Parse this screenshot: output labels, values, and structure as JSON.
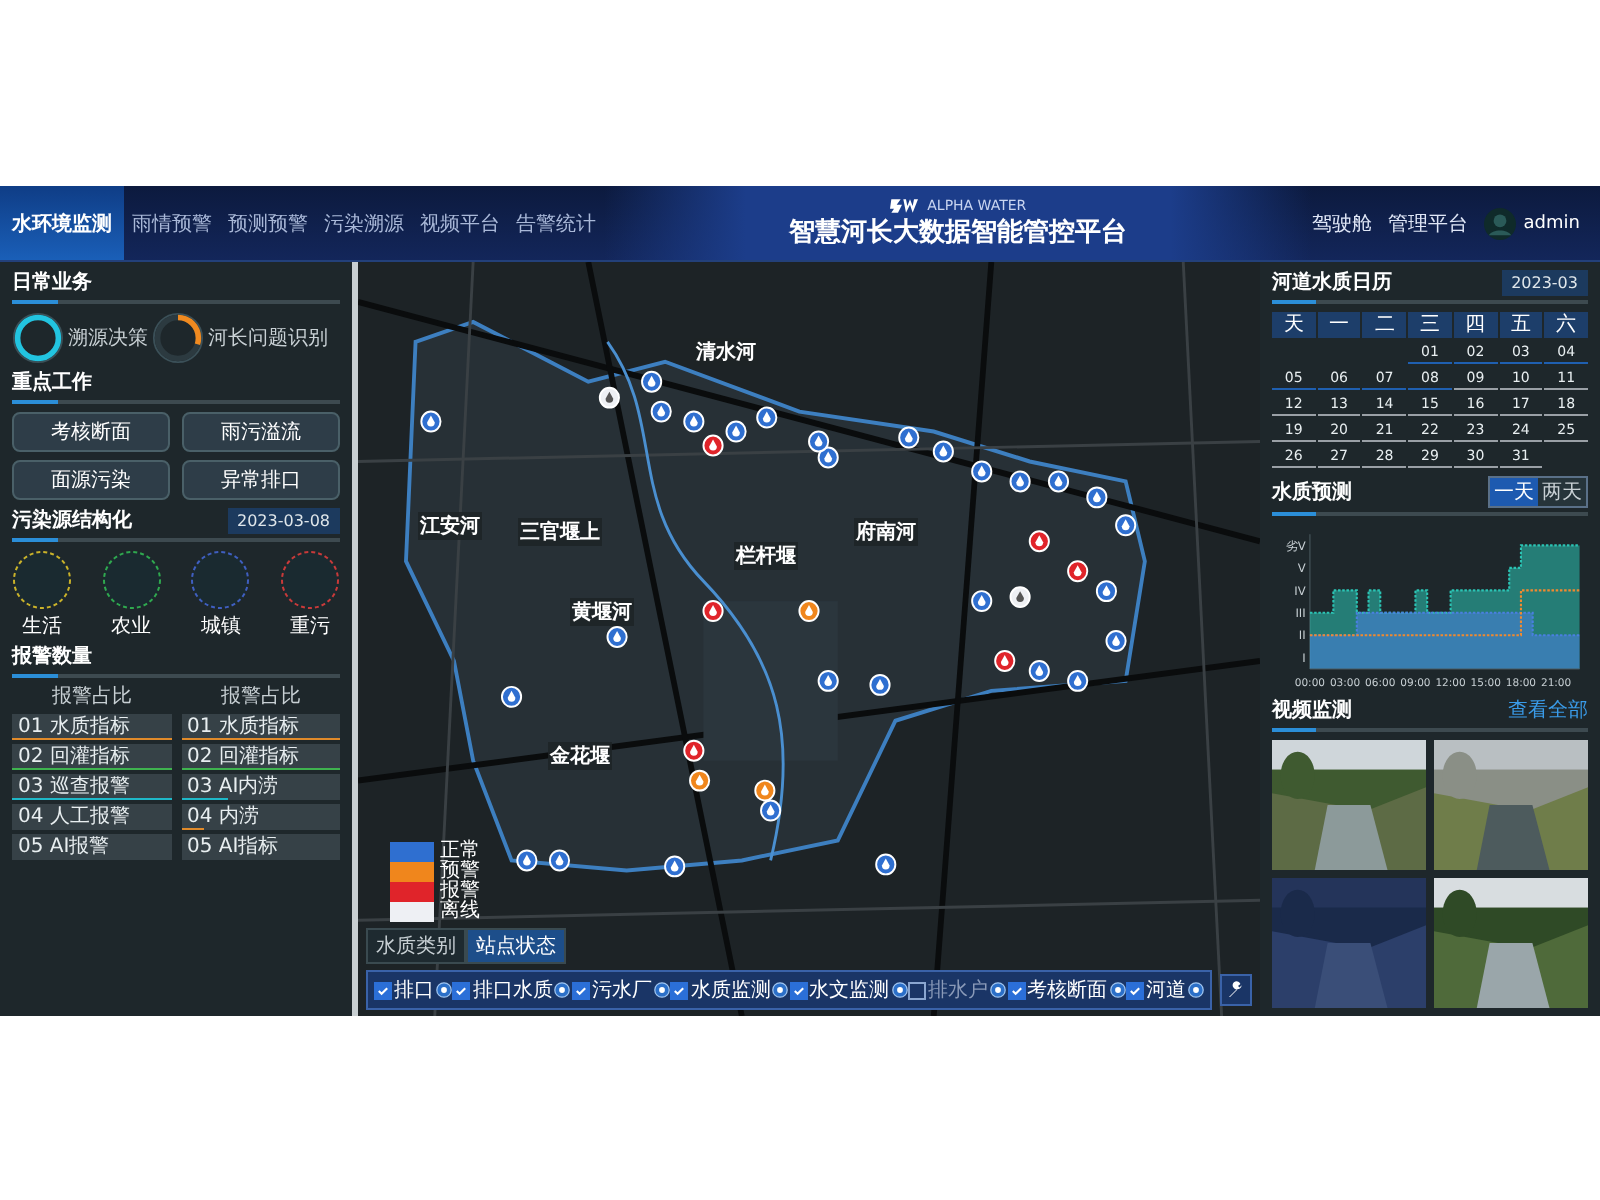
{
  "header": {
    "nav_tabs": [
      {
        "label": "水环境监测",
        "selected": true
      },
      {
        "label": "雨情预警",
        "selected": false
      },
      {
        "label": "预测预警",
        "selected": false
      },
      {
        "label": "污染溯源",
        "selected": false
      },
      {
        "label": "视频平台",
        "selected": false
      },
      {
        "label": "告警统计",
        "selected": false
      }
    ],
    "brand": "ALPHA WATER",
    "title": "智慧河长大数据智能管控平台",
    "links": [
      "驾驶舱",
      "管理平台"
    ],
    "user": "admin"
  },
  "left": {
    "daily": {
      "title": "日常业务",
      "gauges": [
        {
          "label": "溯源决策",
          "level": 1
        },
        {
          "label": "河长问题识别",
          "level": 0.3
        }
      ]
    },
    "key_work": {
      "title": "重点工作",
      "cards": [
        "考核断面",
        "雨污溢流",
        "面源污染",
        "异常排口"
      ]
    },
    "pollution": {
      "title": "污染源结构化",
      "date": "2023-03-08",
      "sources": [
        {
          "label": "生活",
          "color": "#c9b22a"
        },
        {
          "label": "农业",
          "color": "#2fa84f"
        },
        {
          "label": "城镇",
          "color": "#3f5fc0"
        },
        {
          "label": "重污",
          "color": "#c83a3a"
        }
      ]
    },
    "alarms": {
      "title": "报警数量",
      "columns": [
        {
          "heading": "报警占比",
          "rows": [
            {
              "label": "01 水质指标",
              "level": 1,
              "color": "#e08a2a"
            },
            {
              "label": "02 回灌指标",
              "level": 1,
              "color": "#3fb34f"
            },
            {
              "label": "03 巡查报警",
              "level": 1,
              "color": "#1fb8c8"
            },
            {
              "label": "04 人工报警"
            },
            {
              "label": "05 AI报警"
            }
          ]
        },
        {
          "heading": "报警占比",
          "rows": [
            {
              "label": "01 水质指标",
              "level": 1,
              "color": "#e08a2a"
            },
            {
              "label": "02 回灌指标",
              "level": 1,
              "color": "#3fb34f"
            },
            {
              "label": "03 AI内涝",
              "level": 0.3,
              "color": "#1fb8c8"
            },
            {
              "label": "04 内涝",
              "level": 0.15,
              "color": "#e08a2a"
            },
            {
              "label": "05 AI指标"
            }
          ]
        }
      ]
    }
  },
  "map": {
    "labels": [
      "江安河",
      "清水河",
      "三官堰上",
      "栏杆堰",
      "府南河",
      "黄堰河",
      "金花堰"
    ],
    "legend": [
      {
        "label": "正常",
        "color": "#2f6fd0"
      },
      {
        "label": "预警",
        "color": "#f0861c"
      },
      {
        "label": "报警",
        "color": "#e0242a"
      },
      {
        "label": "离线",
        "color": "#eef0f4"
      }
    ],
    "view_toggle": [
      {
        "label": "水质类别",
        "selected": false
      },
      {
        "label": "站点状态",
        "selected": true
      }
    ],
    "filters": [
      {
        "label": "排口",
        "checked": true
      },
      {
        "label": "排口水质",
        "checked": true
      },
      {
        "label": "污水厂",
        "checked": true
      },
      {
        "label": "水质监测",
        "checked": true
      },
      {
        "label": "水文监测",
        "checked": true
      },
      {
        "label": "排水户",
        "checked": false
      },
      {
        "label": "考核断面",
        "checked": true
      },
      {
        "label": "河道",
        "checked": true
      }
    ]
  },
  "right": {
    "calendar": {
      "title": "河道水质日历",
      "month": "2023-03",
      "weekdays": [
        "天",
        "一",
        "二",
        "三",
        "四",
        "五",
        "六"
      ],
      "days": [
        {
          "day": "01",
          "color": "#1f5fb0"
        },
        {
          "day": "02",
          "color": "#1f5fb0"
        },
        {
          "day": "03",
          "color": "#1f5fb0"
        },
        {
          "day": "04",
          "color": "#1f5fb0"
        },
        {
          "day": "05",
          "color": "#1f5fb0"
        },
        {
          "day": "06",
          "color": "#1f5fb0"
        },
        {
          "day": "07",
          "color": "#1f5fb0"
        },
        {
          "day": "08",
          "color": "#1f5fb0"
        },
        {
          "day": "09",
          "color": "#9aa0a6"
        },
        {
          "day": "10",
          "color": "#9aa0a6"
        },
        {
          "day": "11",
          "color": "#9aa0a6"
        },
        {
          "day": "12",
          "color": "#9aa0a6"
        },
        {
          "day": "13",
          "color": "#9aa0a6"
        },
        {
          "day": "14",
          "color": "#9aa0a6"
        },
        {
          "day": "15",
          "color": "#9aa0a6"
        },
        {
          "day": "16",
          "color": "#9aa0a6"
        },
        {
          "day": "17",
          "color": "#9aa0a6"
        },
        {
          "day": "18",
          "color": "#9aa0a6"
        },
        {
          "day": "19",
          "color": "#9aa0a6"
        },
        {
          "day": "20",
          "color": "#9aa0a6"
        },
        {
          "day": "21",
          "color": "#9aa0a6"
        },
        {
          "day": "22",
          "color": "#9aa0a6"
        },
        {
          "day": "23",
          "color": "#9aa0a6"
        },
        {
          "day": "24",
          "color": "#9aa0a6"
        },
        {
          "day": "25",
          "color": "#9aa0a6"
        },
        {
          "day": "26",
          "color": "#9aa0a6"
        },
        {
          "day": "27",
          "color": "#9aa0a6"
        },
        {
          "day": "28",
          "color": "#9aa0a6"
        },
        {
          "day": "29",
          "color": "#9aa0a6"
        },
        {
          "day": "30",
          "color": "#9aa0a6"
        },
        {
          "day": "31",
          "color": "#9aa0a6"
        }
      ]
    },
    "forecast": {
      "title": "水质预测",
      "ranges": [
        {
          "label": "一天",
          "selected": true
        },
        {
          "label": "两天",
          "selected": false
        }
      ],
      "y_labels": [
        "劣V",
        "V",
        "IV",
        "III",
        "II",
        "I"
      ],
      "x_labels": [
        "00:00",
        "03:00",
        "06:00",
        "09:00",
        "12:00",
        "15:00",
        "18:00",
        "21:00"
      ]
    },
    "video": {
      "title": "视频监测",
      "link": "查看全部"
    }
  }
}
